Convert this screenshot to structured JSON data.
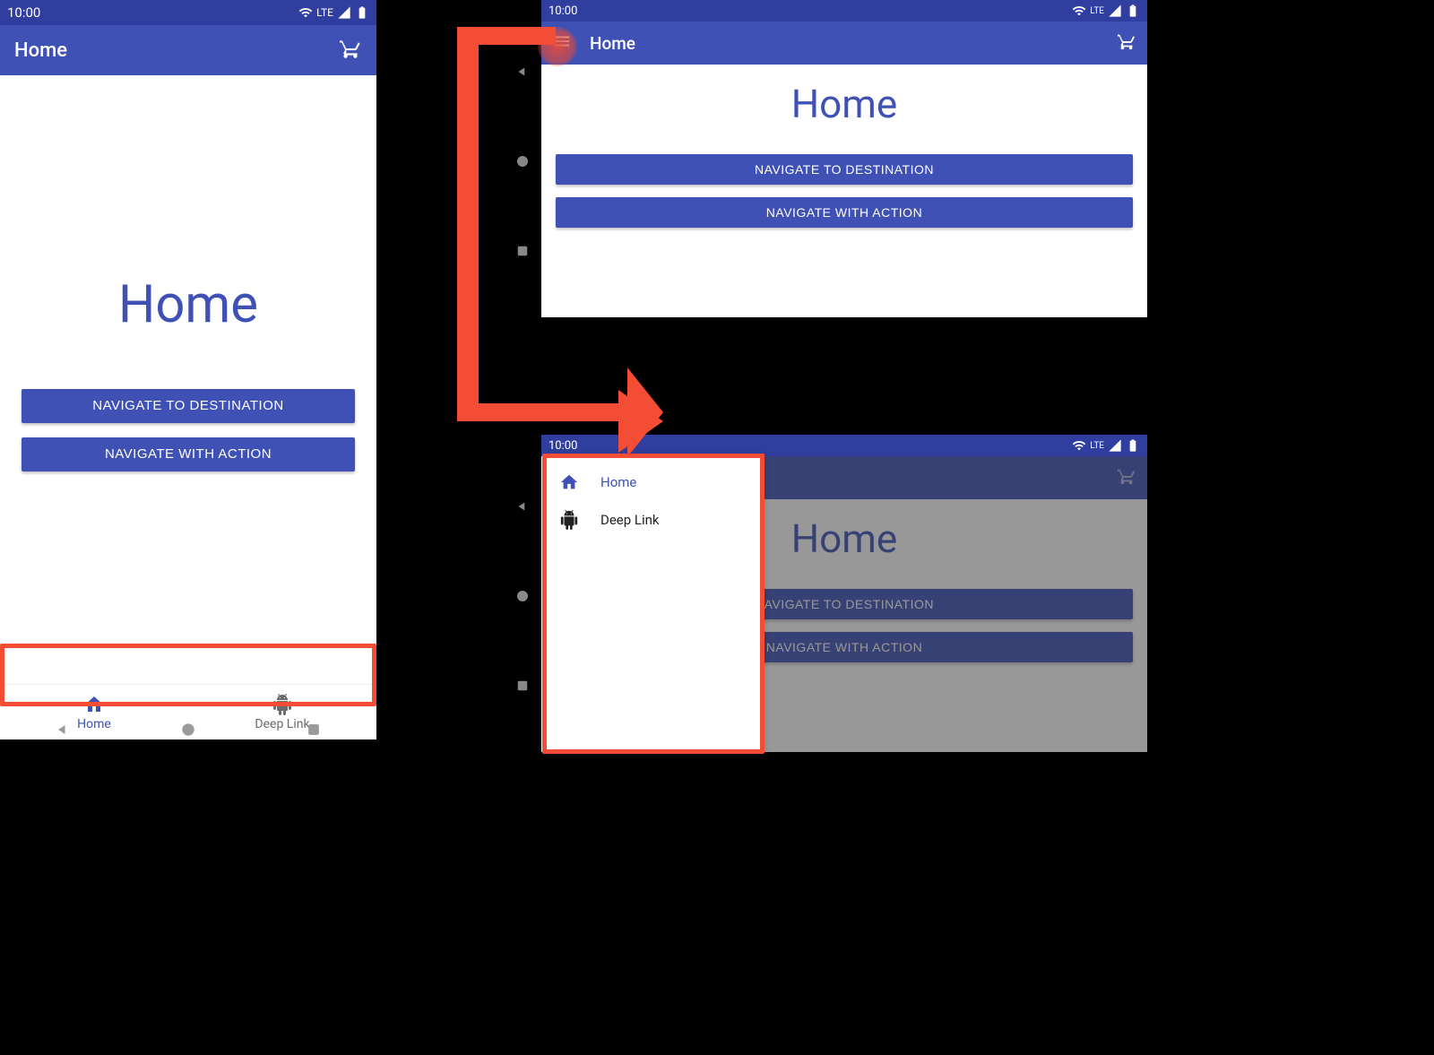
{
  "status": {
    "time": "10:00",
    "network": "LTE"
  },
  "app_bar": {
    "title": "Home"
  },
  "content": {
    "heading": "Home",
    "btn_destination": "NAVIGATE TO DESTINATION",
    "btn_action": "NAVIGATE WITH ACTION"
  },
  "bottom_nav": {
    "home": "Home",
    "deeplink": "Deep Link"
  },
  "drawer": {
    "home": "Home",
    "deeplink": "Deep Link"
  }
}
